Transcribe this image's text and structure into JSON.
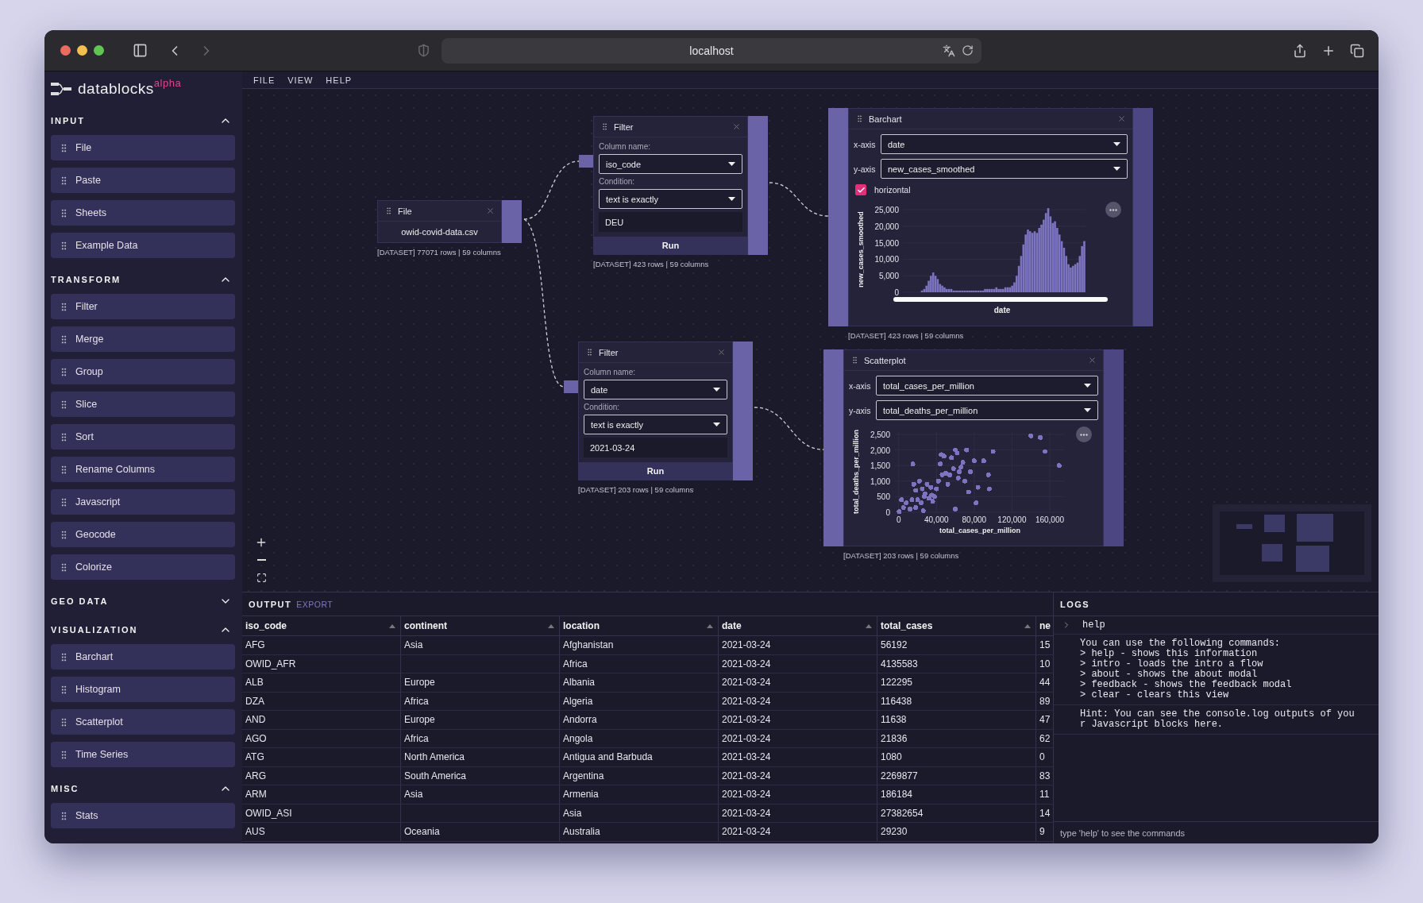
{
  "browser": {
    "url": "localhost"
  },
  "app": {
    "logo": "datablocks",
    "logo_tag": "alpha"
  },
  "menu": [
    "FILE",
    "VIEW",
    "HELP"
  ],
  "sidebar": {
    "sections": [
      {
        "title": "INPUT",
        "expanded": true,
        "items": [
          "File",
          "Paste",
          "Sheets",
          "Example Data"
        ]
      },
      {
        "title": "TRANSFORM",
        "expanded": true,
        "items": [
          "Filter",
          "Merge",
          "Group",
          "Slice",
          "Sort",
          "Rename Columns",
          "Javascript",
          "Geocode",
          "Colorize"
        ]
      },
      {
        "title": "GEO DATA",
        "expanded": false
      },
      {
        "title": "VISUALIZATION",
        "expanded": true,
        "items": [
          "Barchart",
          "Histogram",
          "Scatterplot",
          "Time Series"
        ]
      },
      {
        "title": "MISC",
        "expanded": true,
        "items": [
          "Stats"
        ]
      }
    ]
  },
  "canvas": {
    "nodes": [
      {
        "kind": "file",
        "title": "File",
        "filename": "owid-covid-data.csv",
        "caption": "[DATASET] 77071 rows | 59 columns"
      },
      {
        "kind": "filter",
        "title": "Filter",
        "column_label": "Column name:",
        "column": "iso_code",
        "condition_label": "Condition:",
        "condition": "text is exactly",
        "value": "DEU",
        "run": "Run",
        "caption": "[DATASET] 423 rows | 59 columns"
      },
      {
        "kind": "filter",
        "title": "Filter",
        "column_label": "Column name:",
        "column": "date",
        "condition_label": "Condition:",
        "condition": "text is exactly",
        "value": "2021-03-24",
        "run": "Run",
        "caption": "[DATASET] 203 rows | 59 columns"
      },
      {
        "kind": "barchart",
        "title": "Barchart",
        "x_label": "x-axis",
        "x_value": "date",
        "y_label": "y-axis",
        "y_value": "new_cases_smoothed",
        "checkbox": {
          "label": "horizontal",
          "checked": true
        },
        "caption": "[DATASET] 423 rows | 59 columns",
        "chart_data": {
          "type": "bar",
          "xlabel": "date",
          "ylabel": "new_cases_smoothed",
          "ylim": [
            0,
            26000
          ],
          "yticks": [
            {
              "value": 0,
              "label": "0"
            },
            {
              "value": 5000,
              "label": "5,000"
            },
            {
              "value": 10000,
              "label": "10,000"
            },
            {
              "value": 15000,
              "label": "15,000"
            },
            {
              "value": 20000,
              "label": "20,000"
            },
            {
              "value": 25000,
              "label": "25,000"
            }
          ],
          "grid": true,
          "series": [
            {
              "color": "#7c74c0",
              "values": [
                0,
                0,
                0,
                0,
                0,
                0,
                0,
                0,
                500,
                1000,
                2000,
                3500,
                5000,
                6000,
                5000,
                4000,
                2500,
                2000,
                1500,
                1000,
                1000,
                1000,
                500,
                500,
                500,
                500,
                500,
                500,
                500,
                500,
                500,
                500,
                500,
                500,
                500,
                500,
                1000,
                1000,
                1000,
                1000,
                1000,
                1500,
                1000,
                1000,
                1000,
                1500,
                1500,
                1500,
                2000,
                3000,
                5000,
                8000,
                11000,
                14500,
                17500,
                19000,
                18500,
                18000,
                18500,
                18000,
                19500,
                20500,
                22000,
                24000,
                25500,
                23000,
                21000,
                21500,
                19500,
                17500,
                15500,
                13500,
                11000,
                8500,
                7500,
                8000,
                8500,
                9000,
                11000,
                14000,
                15500
              ]
            }
          ]
        }
      },
      {
        "kind": "scatterplot",
        "title": "Scatterplot",
        "x_label": "x-axis",
        "x_value": "total_cases_per_million",
        "y_label": "y-axis",
        "y_value": "total_deaths_per_million",
        "caption": "[DATASET] 203 rows | 59 columns",
        "chart_data": {
          "type": "scatter",
          "xlabel": "total_cases_per_million",
          "ylabel": "total_deaths_per_million",
          "xlim": [
            -4000,
            176000
          ],
          "ylim": [
            0,
            2600
          ],
          "xticks": [
            {
              "value": 0,
              "label": "0"
            },
            {
              "value": 40000,
              "label": "40,000"
            },
            {
              "value": 80000,
              "label": "80,000"
            },
            {
              "value": 120000,
              "label": "120,000"
            },
            {
              "value": 160000,
              "label": "160,000"
            }
          ],
          "yticks": [
            {
              "value": 0,
              "label": "0"
            },
            {
              "value": 500,
              "label": "500"
            },
            {
              "value": 1000,
              "label": "1,000"
            },
            {
              "value": 1500,
              "label": "1,500"
            },
            {
              "value": 2000,
              "label": "2,000"
            },
            {
              "value": 2500,
              "label": "2,500"
            }
          ],
          "x": [
            500,
            5000,
            8000,
            12000,
            14000,
            3000,
            15000,
            16000,
            18000,
            20000,
            22000,
            24000,
            25000,
            27000,
            28000,
            30000,
            32000,
            34000,
            36000,
            38000,
            40000,
            42000,
            44000,
            46000,
            48000,
            50000,
            52000,
            54000,
            56000,
            58000,
            60000,
            62000,
            64000,
            66000,
            68000,
            70000,
            72000,
            74000,
            76000,
            80000,
            82000,
            84000,
            90000,
            95000,
            96000,
            100000,
            140000,
            150000,
            155000,
            170000,
            18000,
            45000,
            60000,
            35000,
            26000,
            63000
          ],
          "grid": true,
          "series": [
            {
              "color": "#7c74c0",
              "values": [
                20,
                150,
                300,
                100,
                400,
                400,
                1550,
                900,
                700,
                400,
                1000,
                300,
                750,
                500,
                600,
                900,
                450,
                800,
                350,
                500,
                750,
                1000,
                1550,
                1200,
                1800,
                1250,
                900,
                1200,
                1750,
                1400,
                2000,
                1900,
                1300,
                1450,
                1600,
                1000,
                2000,
                650,
                1300,
                1650,
                300,
                800,
                1650,
                1200,
                750,
                1950,
                2450,
                2400,
                1950,
                1500,
                150,
                1850,
                100,
                550,
                50,
                1100
              ]
            }
          ]
        }
      }
    ]
  },
  "output": {
    "title": "OUTPUT",
    "export": "EXPORT",
    "columns": [
      "iso_code",
      "continent",
      "location",
      "date",
      "total_cases",
      "ne"
    ],
    "rows": [
      [
        "AFG",
        "Asia",
        "Afghanistan",
        "2021-03-24",
        "56192",
        "15"
      ],
      [
        "OWID_AFR",
        "",
        "Africa",
        "2021-03-24",
        "4135583",
        "10"
      ],
      [
        "ALB",
        "Europe",
        "Albania",
        "2021-03-24",
        "122295",
        "44"
      ],
      [
        "DZA",
        "Africa",
        "Algeria",
        "2021-03-24",
        "116438",
        "89"
      ],
      [
        "AND",
        "Europe",
        "Andorra",
        "2021-03-24",
        "11638",
        "47"
      ],
      [
        "AGO",
        "Africa",
        "Angola",
        "2021-03-24",
        "21836",
        "62"
      ],
      [
        "ATG",
        "North America",
        "Antigua and Barbuda",
        "2021-03-24",
        "1080",
        "0"
      ],
      [
        "ARG",
        "South America",
        "Argentina",
        "2021-03-24",
        "2269877",
        "83"
      ],
      [
        "ARM",
        "Asia",
        "Armenia",
        "2021-03-24",
        "186184",
        "11"
      ],
      [
        "OWID_ASI",
        "",
        "Asia",
        "2021-03-24",
        "27382654",
        "14"
      ],
      [
        "AUS",
        "Oceania",
        "Australia",
        "2021-03-24",
        "29230",
        "9"
      ]
    ]
  },
  "logs": {
    "title": "LOGS",
    "command": "help",
    "lines": [
      "You can use the following commands:",
      "> help - shows this information",
      "> intro - loads the intro a flow",
      "> about - shows the about modal",
      "> feedback - shows the feedback modal",
      "> clear - clears this view"
    ],
    "hint": "Hint: You can see the console.log outputs of your Javascript blocks here.",
    "placeholder": "type 'help' to see the commands"
  }
}
